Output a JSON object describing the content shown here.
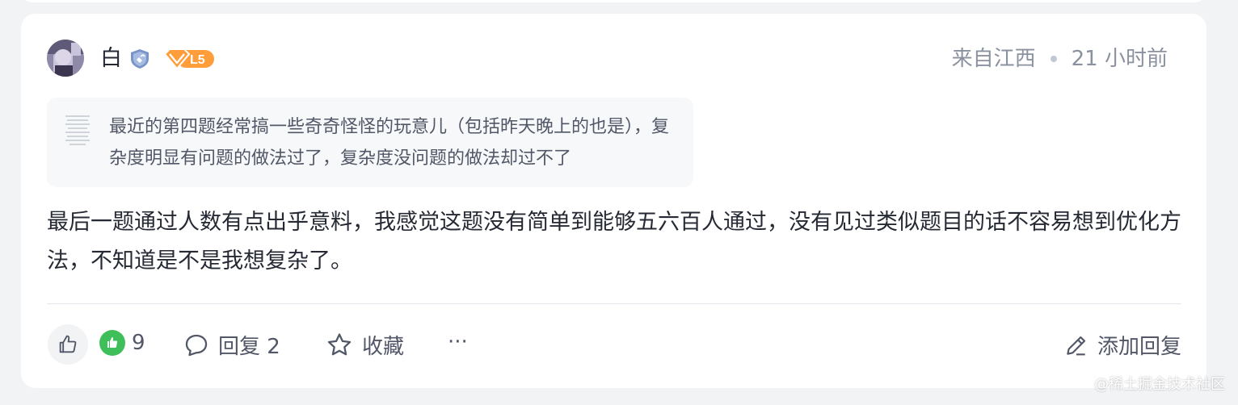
{
  "comment": {
    "username": "白",
    "level": "L5",
    "location": "来自江西",
    "time": "21 小时前",
    "quoted_text": "最近的第四题经常搞一些奇奇怪怪的玩意儿（包括昨天晚上的也是），复杂度明显有问题的做法过了，复杂度没问题的做法却过不了",
    "content": "最后一题通过人数有点出乎意料，我感觉这题没有简单到能够五六百人通过，没有见过类似题目的话不容易想到优化方法，不知道是不是我想复杂了。"
  },
  "actions": {
    "like_count": "9",
    "reply_label": "回复 2",
    "favorite_label": "收藏",
    "more_label": "···",
    "add_reply_label": "添加回复"
  },
  "watermark": "@稀土掘金技术社区",
  "colors": {
    "level_badge": "#ff9d3a",
    "like_green": "#3fbf59",
    "text_primary": "#252933",
    "text_secondary": "#8a919f"
  },
  "icons": {
    "avatar": "user-avatar",
    "badge": "shield-badge-icon",
    "level": "diamond-level-icon",
    "like": "thumbs-up-icon",
    "reply": "chat-bubble-icon",
    "favorite": "star-icon",
    "more": "more-dots-icon",
    "add_reply": "pencil-icon"
  }
}
